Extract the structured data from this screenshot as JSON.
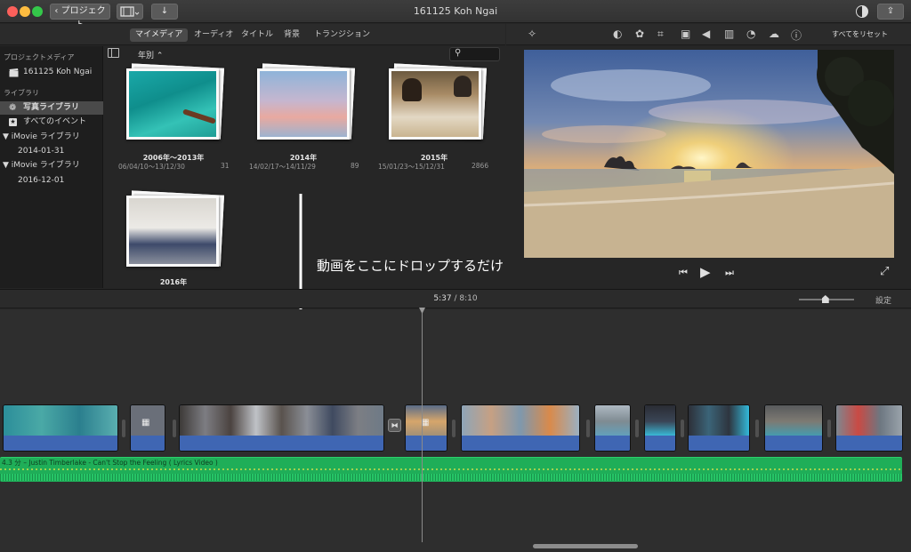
{
  "window": {
    "title": "161125 Koh Ngai"
  },
  "toolbar": {
    "back_label": "プロジェクト",
    "download_glyph": "↓",
    "share_glyph": "⇪"
  },
  "browser_tabs": [
    "マイメディア",
    "オーディオ",
    "タイトル",
    "背景",
    "トランジション"
  ],
  "browser": {
    "sort_label": "年別 ⌃"
  },
  "sidebar": {
    "project_media_header": "プロジェクトメディア",
    "project_item": "161125 Koh Ngai",
    "library_header": "ライブラリ",
    "items": [
      {
        "label": "写真ライブラリ",
        "selected": true
      },
      {
        "label": "すべてのイベント",
        "selected": false
      },
      {
        "label": "▼ iMovie ライブラリ",
        "selected": false
      },
      {
        "label": "2014-01-31",
        "selected": false
      },
      {
        "label": "▼ iMovie ライブラリ",
        "selected": false
      },
      {
        "label": "2016-12-01",
        "selected": false
      }
    ]
  },
  "events": [
    {
      "title": "2006年～2013年",
      "dates": "06/04/10～13/12/30",
      "count": "31"
    },
    {
      "title": "2014年",
      "dates": "14/02/17～14/11/29",
      "count": "89"
    },
    {
      "title": "2015年",
      "dates": "15/01/23～15/12/31",
      "count": "2866"
    },
    {
      "title": "2016年",
      "dates": "",
      "count": ""
    }
  ],
  "viewer": {
    "reset_all": "すべてをリセット"
  },
  "annotation": {
    "text": "動画をここにドロップするだけ"
  },
  "timeline": {
    "current_time": "5:37",
    "separator": "/",
    "total_time": "8:10",
    "settings_label": "設定",
    "zoom_level": 0.48
  },
  "audio_track": {
    "label": "4.3 分 – Justin Timberlake - Can't Stop the Feeling ( Lyrics Video )"
  },
  "colors": {
    "accent_blue": "#3c6bbd",
    "audio_green": "#1fae58",
    "selection": "#4a4a4a"
  }
}
